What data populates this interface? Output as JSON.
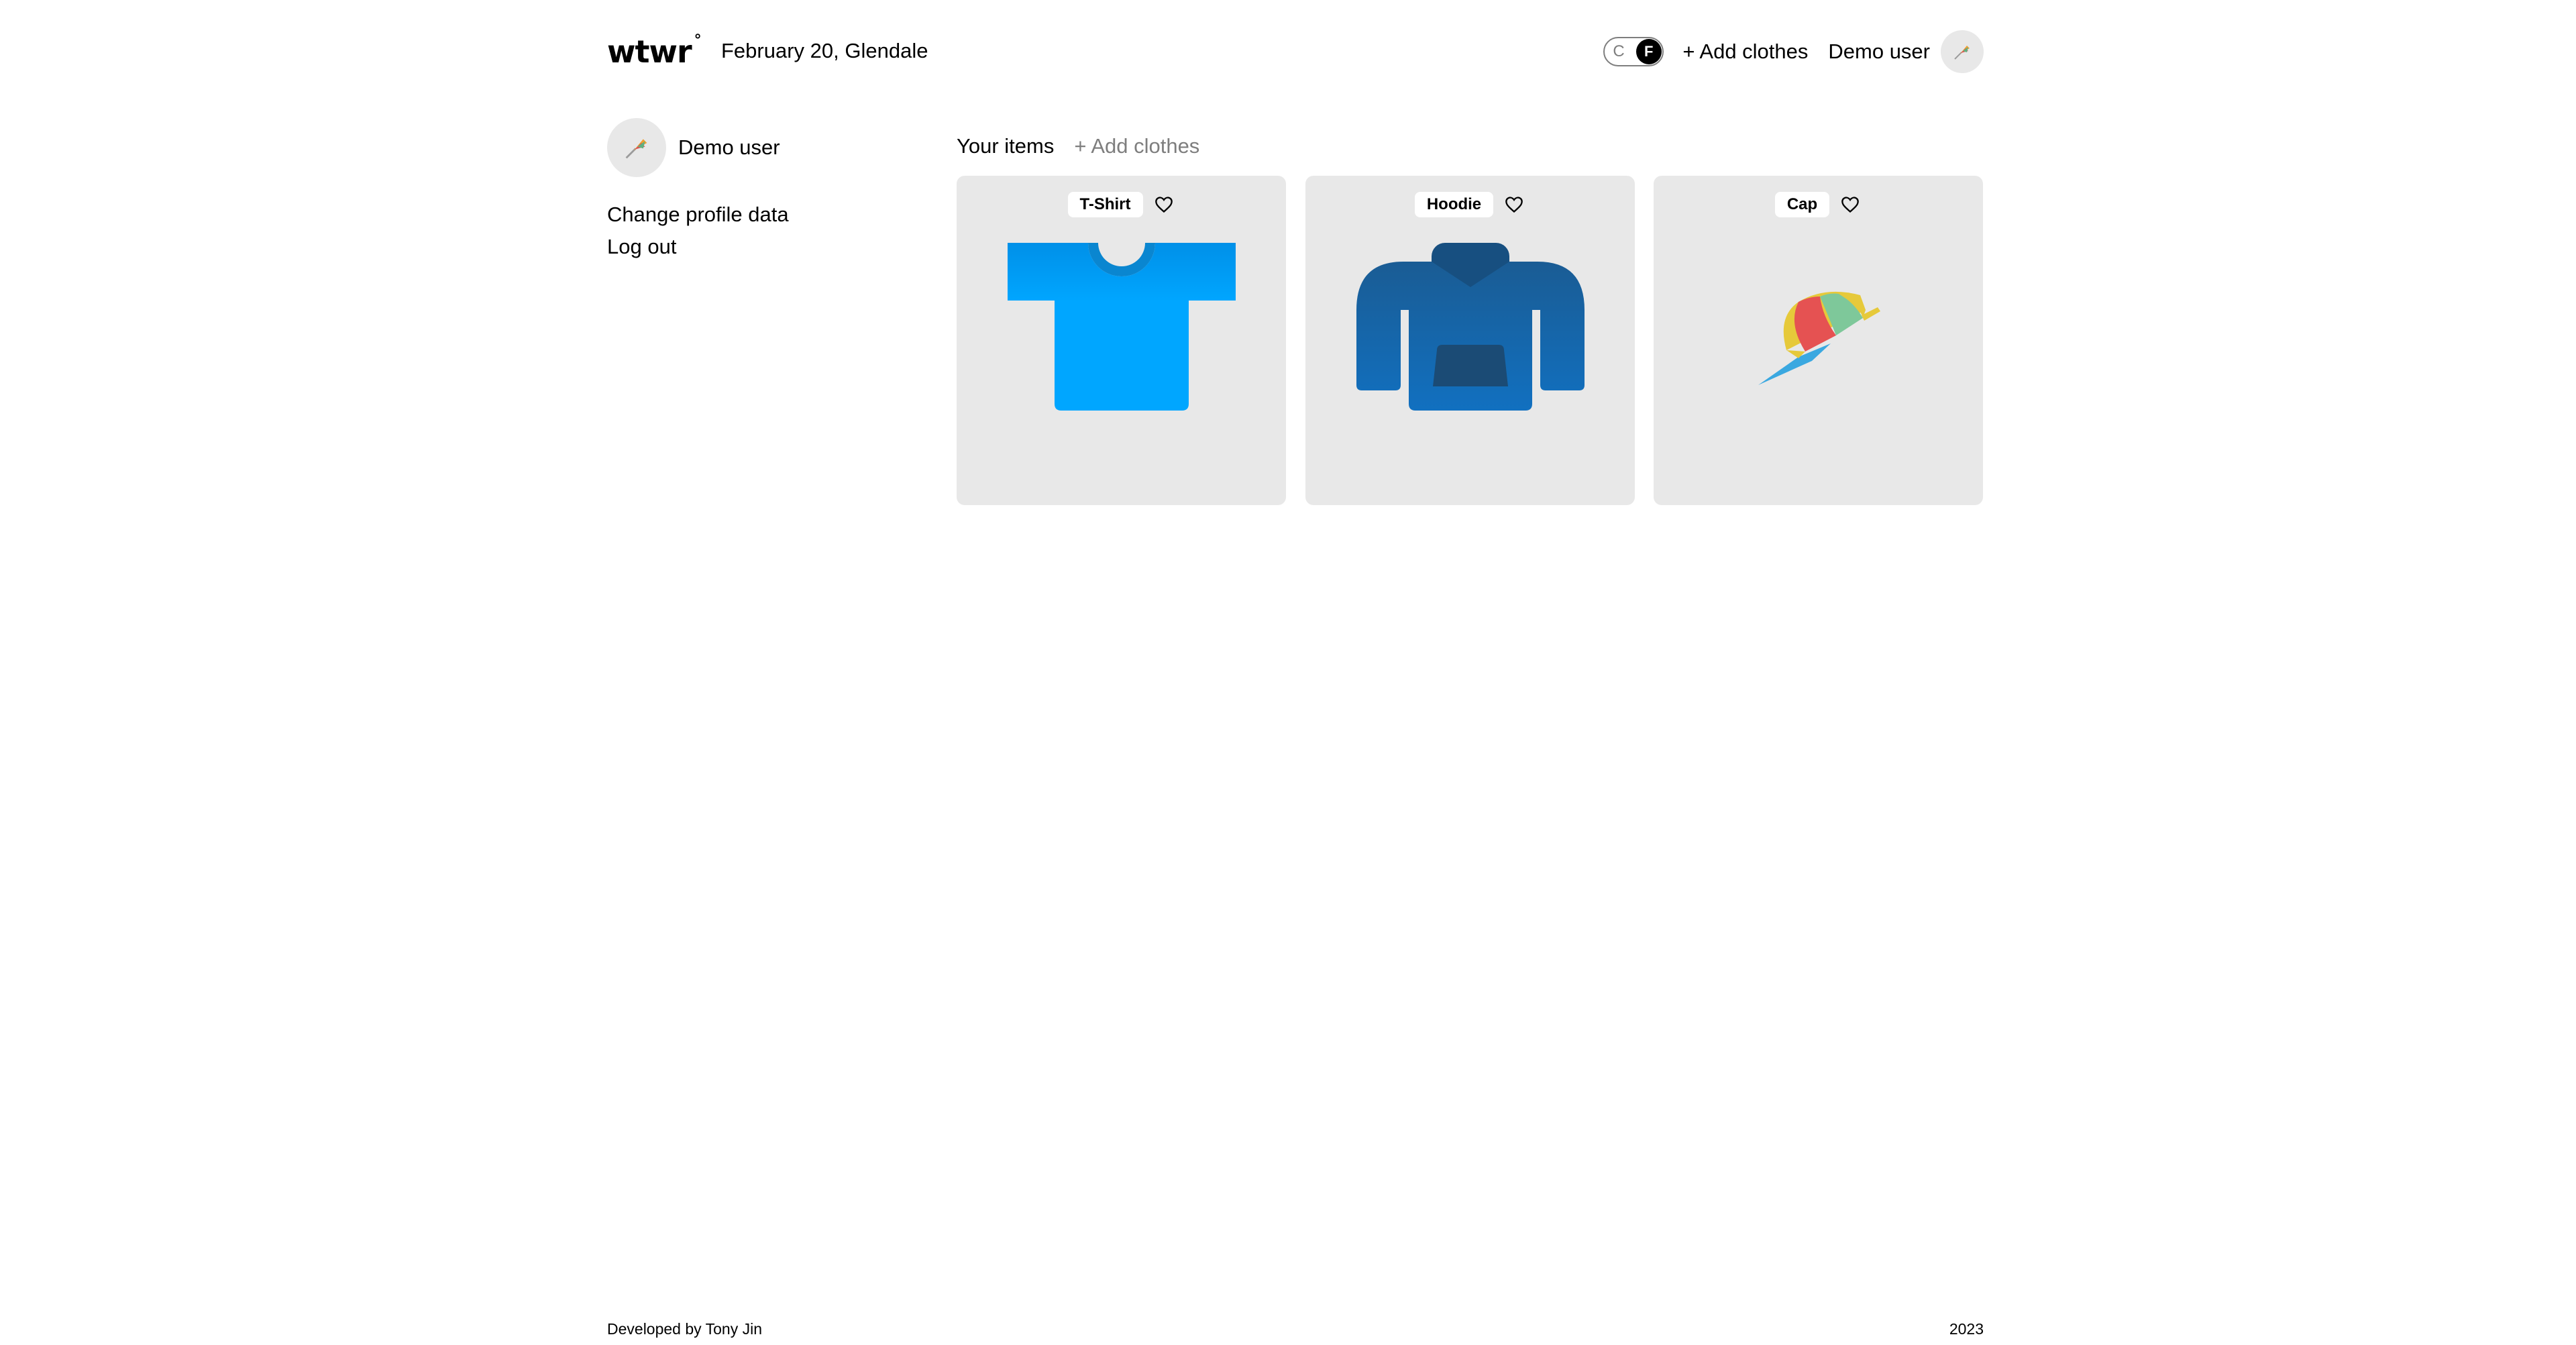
{
  "header": {
    "logo": "wtwr",
    "logo_mark": "°",
    "date_location": "February 20, Glendale",
    "toggle": {
      "left": "C",
      "right": "F",
      "active": "F"
    },
    "add_clothes": "+ Add clothes",
    "user_name": "Demo user"
  },
  "sidebar": {
    "user_name": "Demo user",
    "links": [
      "Change profile data",
      "Log out"
    ]
  },
  "main": {
    "title": "Your items",
    "add_clothes": "+ Add clothes",
    "items": [
      {
        "name": "T-Shirt",
        "icon": "tshirt-icon",
        "liked": false
      },
      {
        "name": "Hoodie",
        "icon": "hoodie-icon",
        "liked": false
      },
      {
        "name": "Cap",
        "icon": "cap-icon",
        "liked": false
      }
    ]
  },
  "footer": {
    "credit": "Developed by Tony Jin",
    "year": "2023"
  },
  "colors": {
    "card_bg": "#e8e8e8",
    "muted_text": "#7e7e7e",
    "tshirt_blue": "#00a6ff",
    "hoodie_blue": "#1a66a8"
  }
}
